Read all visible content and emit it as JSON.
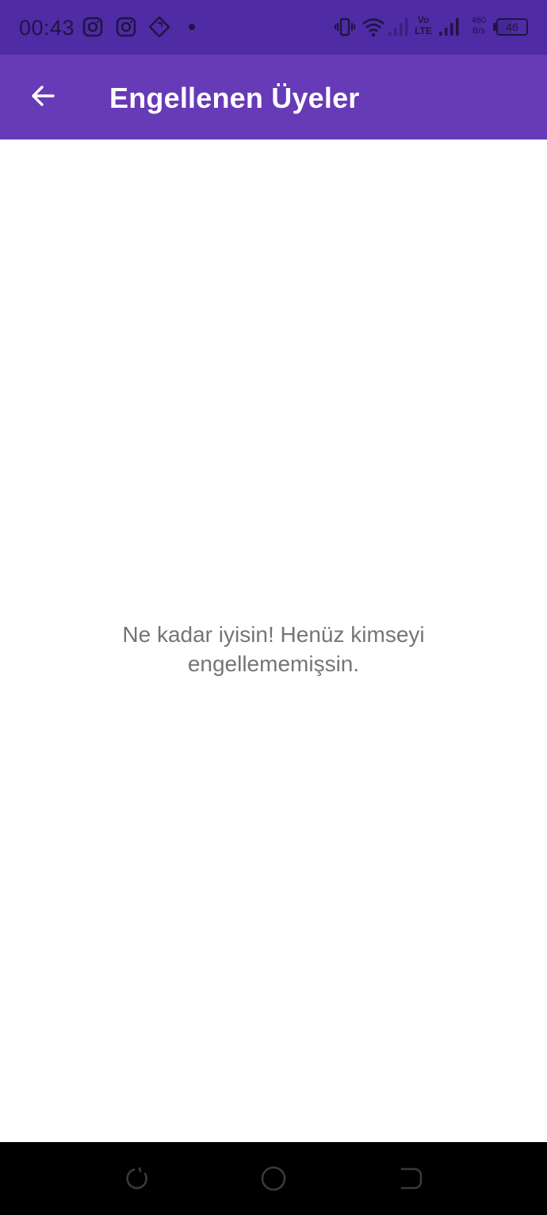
{
  "status_bar": {
    "time": "00:43",
    "notification_icons": [
      "instagram-icon",
      "instagram-icon",
      "navigation-diamond-icon",
      "dot-icon"
    ],
    "volte_line1": "Vo",
    "volte_line2": "LTE",
    "net_speed_value": "460",
    "net_speed_unit": "B/s",
    "battery_level": "46",
    "background_color": "#4f2ba6"
  },
  "app_bar": {
    "title": "Engellenen Üyeler",
    "back_icon": "arrow-left-icon",
    "background_color": "#673ab7"
  },
  "content": {
    "empty_message": "Ne kadar iyisin! Henüz kimseyi engellememişsin."
  },
  "nav_bar": {
    "buttons": [
      "recent-apps-icon",
      "home-icon",
      "back-icon"
    ]
  }
}
